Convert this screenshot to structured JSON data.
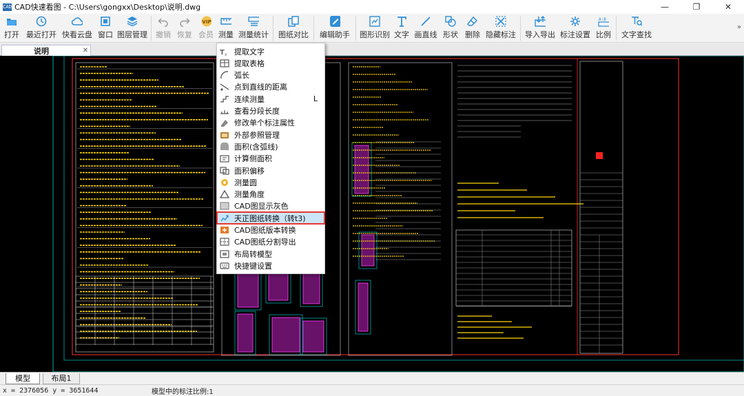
{
  "window": {
    "app_icon_text": "CAD",
    "title": "CAD快速看图 - C:\\Users\\gongxx\\Desktop\\说明.dwg",
    "minimize": "—",
    "restore": "❐",
    "close": "✕"
  },
  "toolbar": {
    "open": "打开",
    "recent": "最近打开",
    "cloud": "快看云盘",
    "window": "窗口",
    "layers": "图层管理",
    "undo": "撤销",
    "redo": "恢复",
    "vip": "会员",
    "measure": "测量",
    "measure_stats": "测量统计",
    "compare": "图纸对比",
    "assistant": "编辑助手",
    "recognize": "图形识别",
    "text": "文字",
    "line": "画直线",
    "shape": "形状",
    "delete": "删除",
    "hide_marks": "隐藏标注",
    "import_export": "导入导出",
    "mark_settings": "标注设置",
    "scale": "比例",
    "text_search": "文字查找",
    "more": "»"
  },
  "document_tab": {
    "name": "说明",
    "close": "✕"
  },
  "menu": {
    "items": [
      {
        "label": "提取文字",
        "shortcut": ""
      },
      {
        "label": "提取表格",
        "shortcut": ""
      },
      {
        "label": "弧长",
        "shortcut": ""
      },
      {
        "label": "点到直线的距离",
        "shortcut": ""
      },
      {
        "label": "连续测量",
        "shortcut": "L"
      },
      {
        "label": "查看分段长度",
        "shortcut": ""
      },
      {
        "label": "修改单个标注属性",
        "shortcut": ""
      },
      {
        "label": "外部参照管理",
        "shortcut": ""
      },
      {
        "label": "面积(含弧线)",
        "shortcut": ""
      },
      {
        "label": "计算侧面积",
        "shortcut": ""
      },
      {
        "label": "面积偏移",
        "shortcut": ""
      },
      {
        "label": "测量圆",
        "shortcut": ""
      },
      {
        "label": "测量角度",
        "shortcut": ""
      },
      {
        "label": "CAD图显示灰色",
        "shortcut": ""
      },
      {
        "label": "天正图纸转换（转t3)",
        "shortcut": ""
      },
      {
        "label": "CAD图纸版本转换",
        "shortcut": ""
      },
      {
        "label": "CAD图纸分割导出",
        "shortcut": ""
      },
      {
        "label": "布局转模型",
        "shortcut": ""
      },
      {
        "label": "快捷键设置",
        "shortcut": ""
      }
    ],
    "highlighted_index": 14
  },
  "layout_tabs": {
    "model": "模型",
    "layout1": "布局1"
  },
  "status": {
    "coords": "x = 2376056  y = 3651644",
    "scale_text": "模型中的标注比例:1"
  },
  "colors": {
    "canvas_bg": "#000000",
    "drawing_border": "#00b0b0",
    "drawing_frame": "#ff3030",
    "drawing_text": "#ffd700",
    "menu_highlight": "#cce4f7",
    "highlight_outline": "#e53935"
  }
}
